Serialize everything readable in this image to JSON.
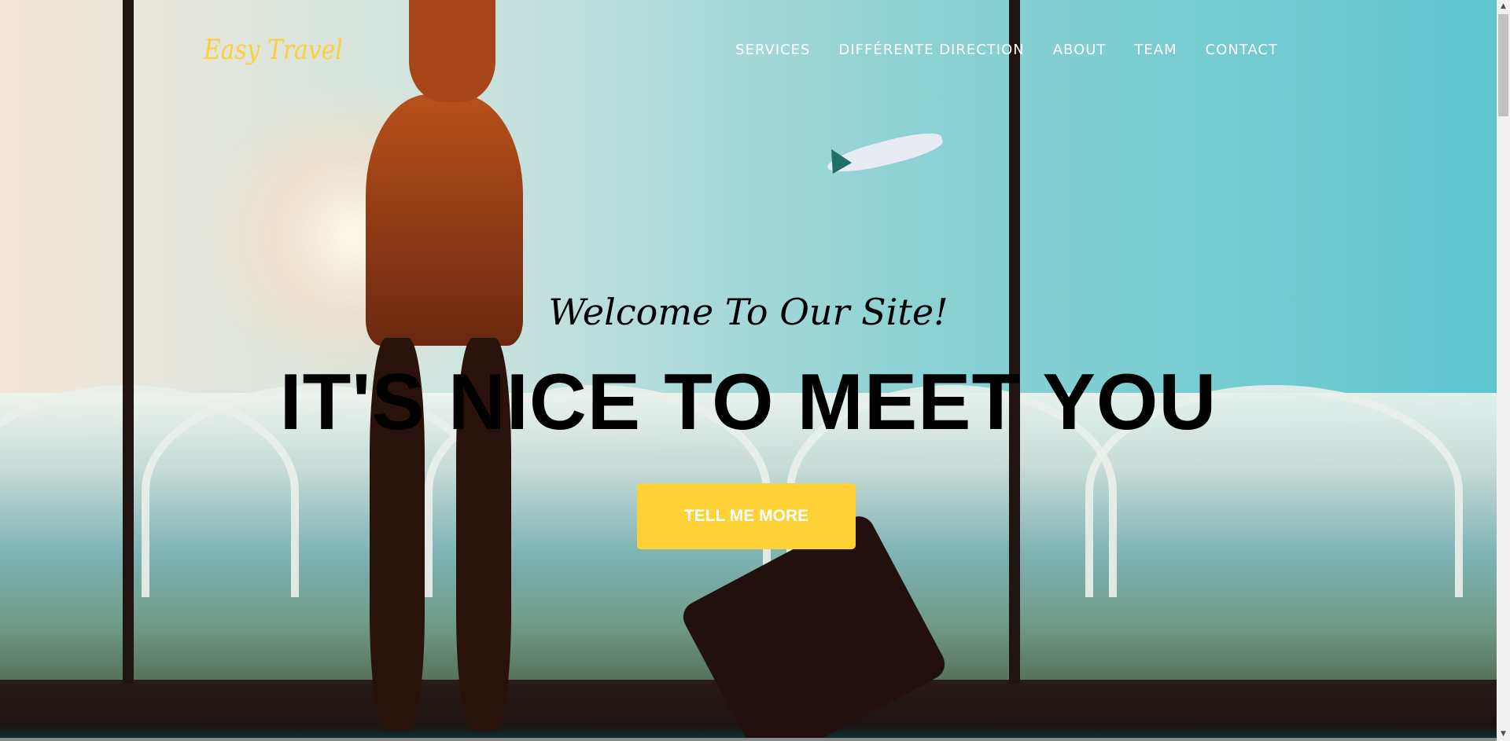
{
  "nav": {
    "logo": "Easy Travel",
    "items": [
      {
        "label": "SERVICES"
      },
      {
        "label": "DIFFÉRENTE DIRECTION"
      },
      {
        "label": "ABOUT"
      },
      {
        "label": "TEAM"
      },
      {
        "label": "CONTACT"
      }
    ]
  },
  "hero": {
    "subheading": "Welcome To Our Site!",
    "heading": "IT'S NICE TO MEET YOU",
    "cta_label": "TELL ME MORE"
  },
  "colors": {
    "accent": "#fed136",
    "nav_text": "#ffffff",
    "heading": "#000000"
  }
}
